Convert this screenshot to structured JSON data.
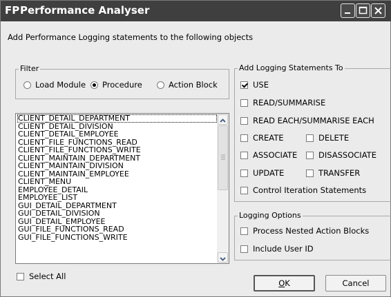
{
  "window": {
    "title": "Performance Analyser",
    "icon": "fp-app-icon"
  },
  "subtitle": "Add Performance Logging statements to the following objects",
  "filter": {
    "label": "Filter",
    "options": [
      "Load Module",
      "Procedure",
      "Action Block"
    ],
    "selected": "Procedure"
  },
  "objects_list": {
    "items": [
      "CLIENT_DETAIL_DEPARTMENT",
      "CLIENT_DETAIL_DIVISION",
      "CLIENT_DETAIL_EMPLOYEE",
      "CLIENT_FILE_FUNCTIONS_READ",
      "CLIENT_FILE_FUNCTIONS_WRITE",
      "CLIENT_MAINTAIN_DEPARTMENT",
      "CLIENT_MAINTAIN_DIVISION",
      "CLIENT_MAINTAIN_EMPLOYEE",
      "CLIENT_MENU",
      "EMPLOYEE_DETAIL",
      "EMPLOYEE_LIST",
      "GUI_DETAIL_DEPARTMENT",
      "GUI_DETAIL_DIVISION",
      "GUI_DETAIL_EMPLOYEE",
      "GUI_FILE_FUNCTIONS_READ",
      "GUI_FILE_FUNCTIONS_WRITE"
    ]
  },
  "select_all": {
    "label": "Select All",
    "checked": false
  },
  "logging_statements": {
    "label": "Add Logging Statements To",
    "use": {
      "label": "USE",
      "checked": true
    },
    "read_summarise": {
      "label": "READ/SUMMARISE",
      "checked": false
    },
    "read_each": {
      "label": "READ EACH/SUMMARISE EACH",
      "checked": false
    },
    "create": {
      "label": "CREATE",
      "checked": false
    },
    "delete": {
      "label": "DELETE",
      "checked": false
    },
    "associate": {
      "label": "ASSOCIATE",
      "checked": false
    },
    "disassociate": {
      "label": "DISASSOCIATE",
      "checked": false
    },
    "update": {
      "label": "UPDATE",
      "checked": false
    },
    "transfer": {
      "label": "TRANSFER",
      "checked": false
    },
    "control_iteration": {
      "label": "Control Iteration Statements",
      "checked": false
    }
  },
  "logging_options": {
    "label": "Logging Options",
    "nested": {
      "label": "Process Nested Action Blocks",
      "checked": false
    },
    "user_id": {
      "label": "Include User ID",
      "checked": false
    }
  },
  "buttons": {
    "ok_mnemonic": "O",
    "ok_rest": "K",
    "cancel": "Cancel"
  },
  "colors": {
    "titlebar": "#3f3f3f",
    "dialog_bg": "#ebebeb"
  }
}
